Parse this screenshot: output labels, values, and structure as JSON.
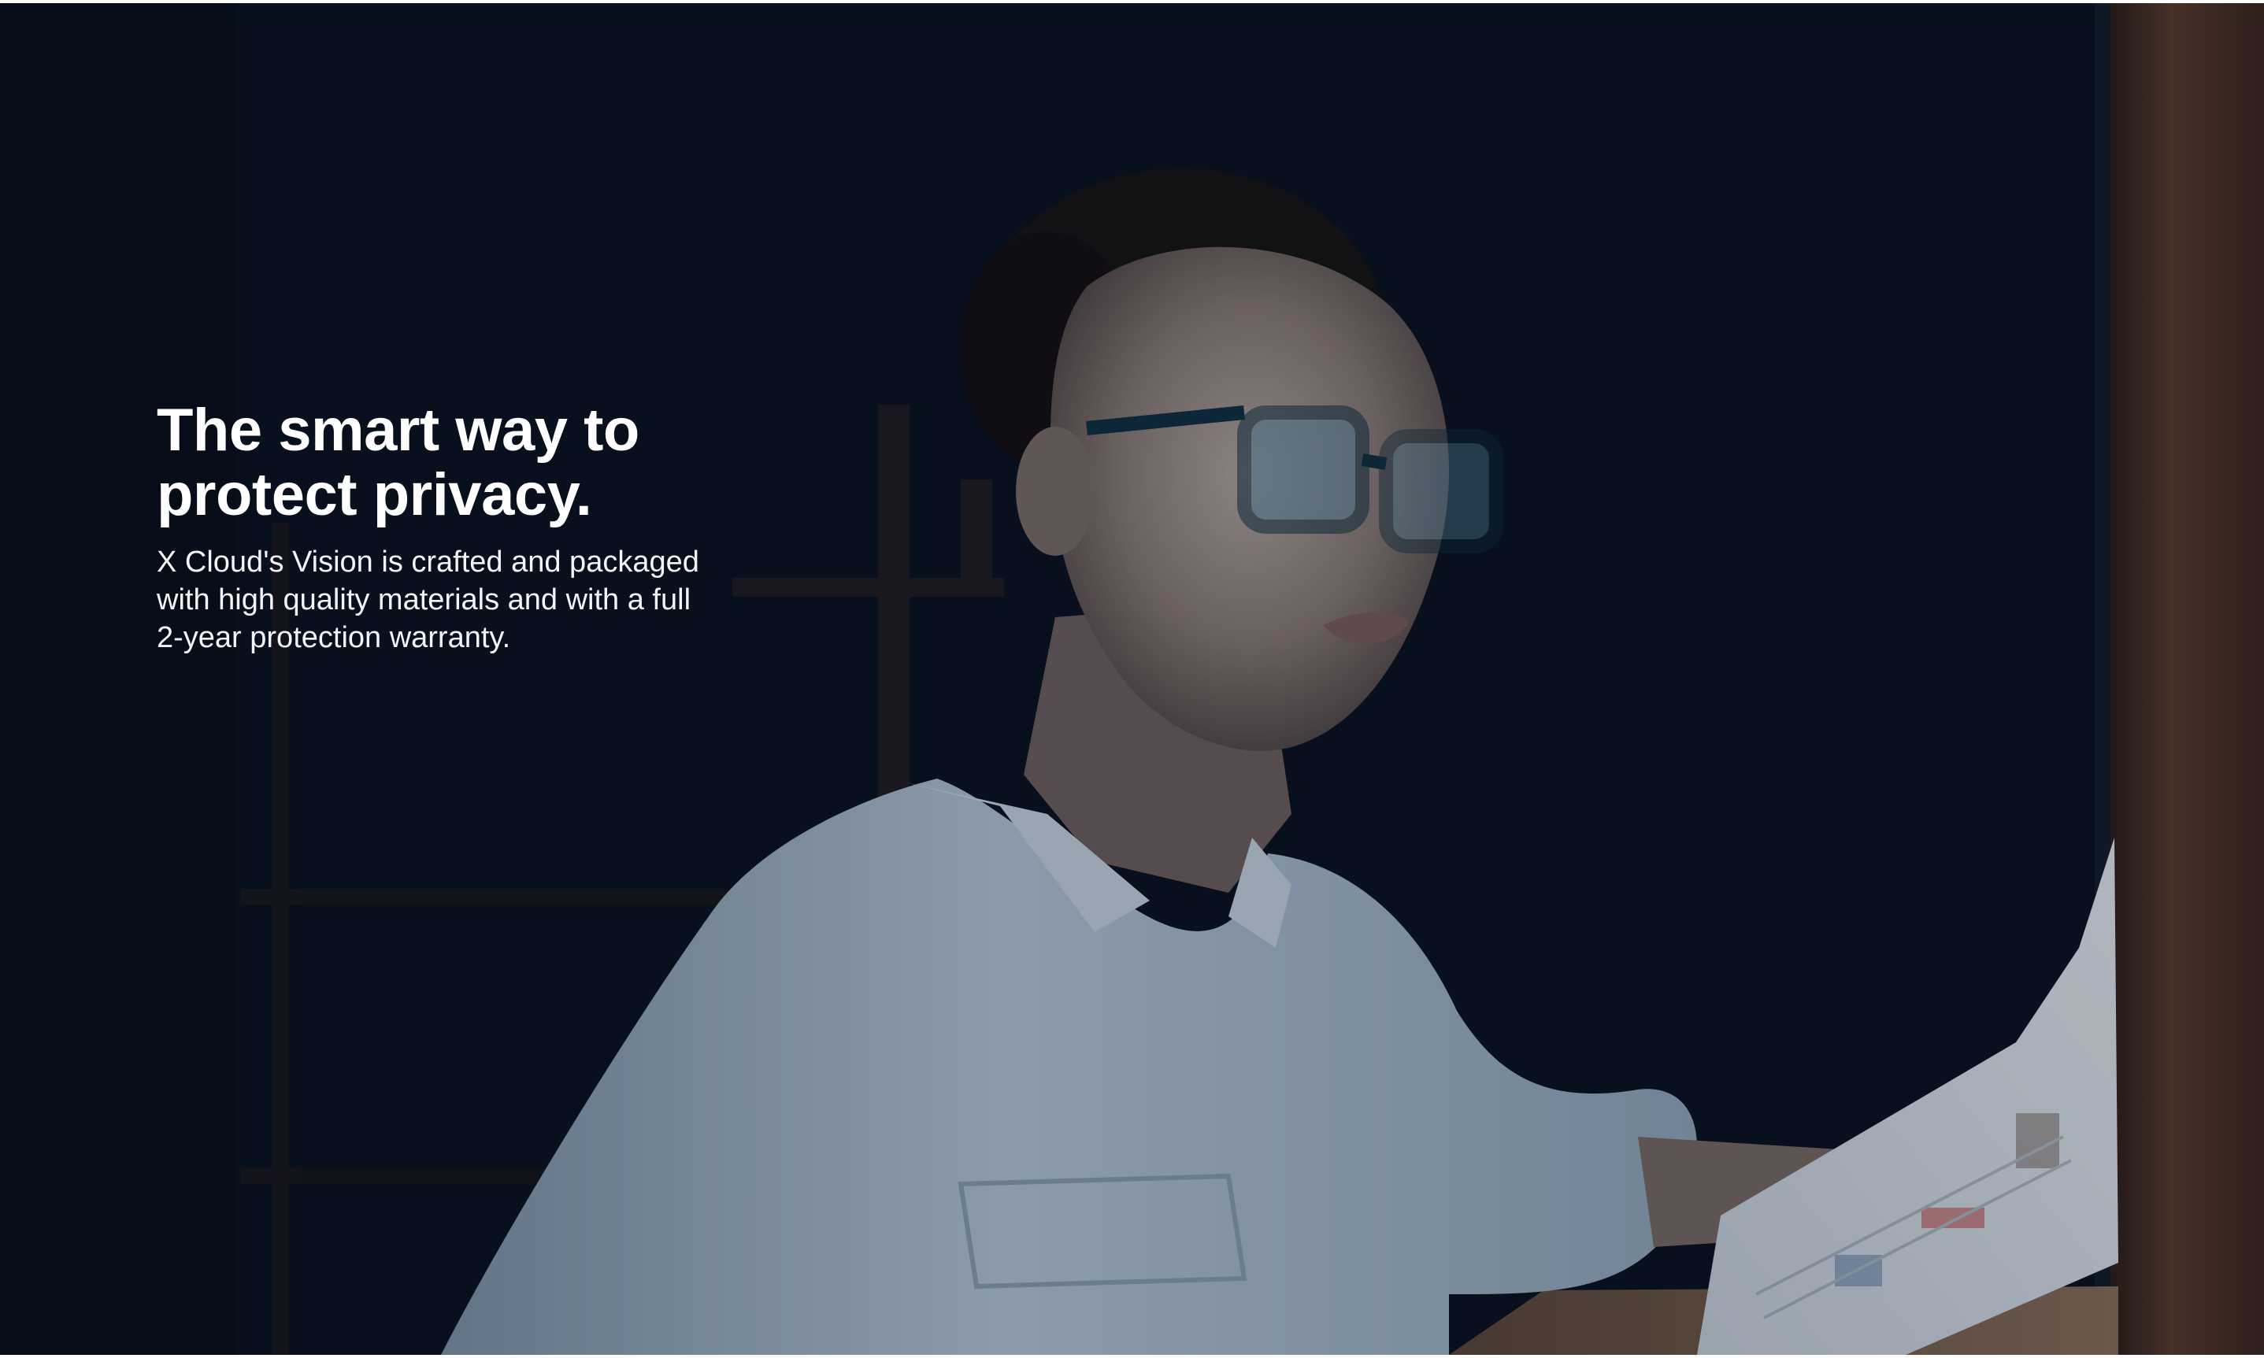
{
  "hero": {
    "headline_line1": "The smart way to",
    "headline_line2": "protect privacy.",
    "body_line1": "X Cloud's Vision is crafted and packaged",
    "body_line2": "with high quality materials and with a full",
    "body_line3": "2-year protection warranty.",
    "image_icon": "woman-with-glasses-photo-icon",
    "colors": {
      "background": "#050b16",
      "text": "#ffffff",
      "shirt": "#9fb3c4",
      "glasses_frame": "#0e2e3f",
      "monitor_edge": "#4a2f22"
    }
  }
}
